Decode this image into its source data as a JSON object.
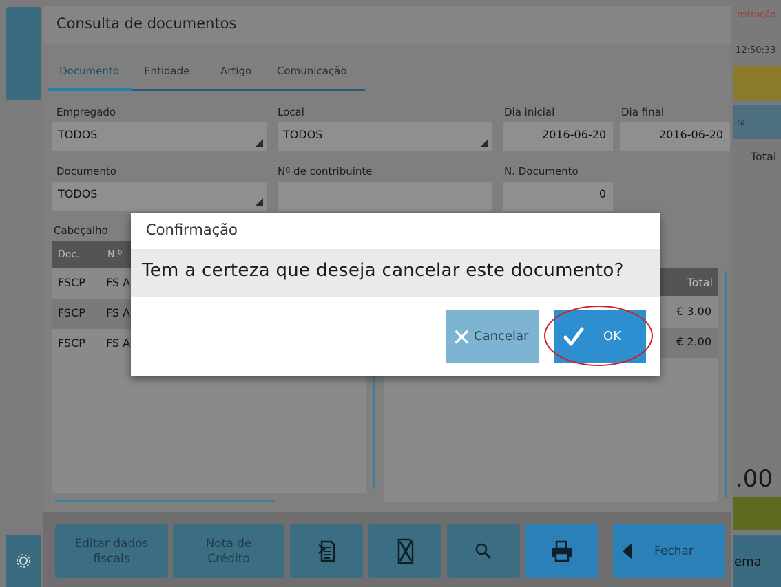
{
  "app": {
    "window_title": "Consulta de documentos",
    "tabs": [
      "Documento",
      "Entidade",
      "Artigo",
      "Comunicação"
    ]
  },
  "right_strip": {
    "mode_text": "nstração",
    "time": "12:50:33",
    "blue_btn": "ra",
    "total_label": "Total",
    "big_amount": ".00",
    "system_btn": "ema"
  },
  "filters": {
    "empregado": {
      "label": "Empregado",
      "value": "TODOS"
    },
    "local": {
      "label": "Local",
      "value": "TODOS"
    },
    "dia_inicial": {
      "label": "Dia inicial",
      "value": "2016-06-20"
    },
    "dia_final": {
      "label": "Dia final",
      "value": "2016-06-20"
    },
    "documento": {
      "label": "Documento",
      "value": "TODOS"
    },
    "contribuinte": {
      "label": "Nº de contribuinte",
      "value": ""
    },
    "n_documento": {
      "label": "N. Documento",
      "value": "0"
    }
  },
  "cabecalho": {
    "label": "Cabeçalho",
    "columns": [
      "Doc.",
      "N.º"
    ],
    "rows": [
      {
        "doc": "FSCP",
        "num": "FS A",
        "highlight": true
      },
      {
        "doc": "FSCP",
        "num": "FS A",
        "highlight": false
      },
      {
        "doc": "FSCP",
        "num": "FS A",
        "highlight": false
      }
    ]
  },
  "linhas": {
    "total_header": "Total",
    "totals": [
      "€ 3.00",
      "€ 2.00"
    ]
  },
  "bottom_buttons": {
    "editar": "Editar dados fiscais",
    "nota": "Nota de Crédito",
    "fechar": "Fechar"
  },
  "dialog": {
    "title": "Confirmação",
    "message": "Tem a certeza que deseja cancelar este documento?",
    "cancel_label": "Cancelar",
    "ok_label": "OK"
  },
  "colors": {
    "accent": "#2e8fd0",
    "highlight_ring": "#d32020"
  }
}
